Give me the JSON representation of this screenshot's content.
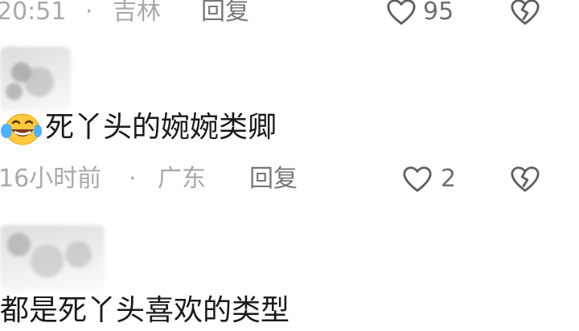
{
  "comment_1": {
    "time": "20:51",
    "separator": "·",
    "location": "吉林",
    "reply_label": "回复",
    "like_count": "95"
  },
  "comment_2": {
    "emoji": "crying-laughing-emoji",
    "text": "死丫头的婉婉类卿",
    "time": "16小时前",
    "separator": "·",
    "location": "广东",
    "reply_label": "回复",
    "like_count": "2"
  },
  "comment_3": {
    "text": "都是死丫头喜欢的类型"
  },
  "icons": {
    "like": "heart-outline-icon",
    "dislike": "broken-heart-icon"
  },
  "colors": {
    "meta_text": "#a9a9a9",
    "reply_text": "#777777",
    "comment_text": "#1a1a1a",
    "icon": "#5f5f5f"
  }
}
